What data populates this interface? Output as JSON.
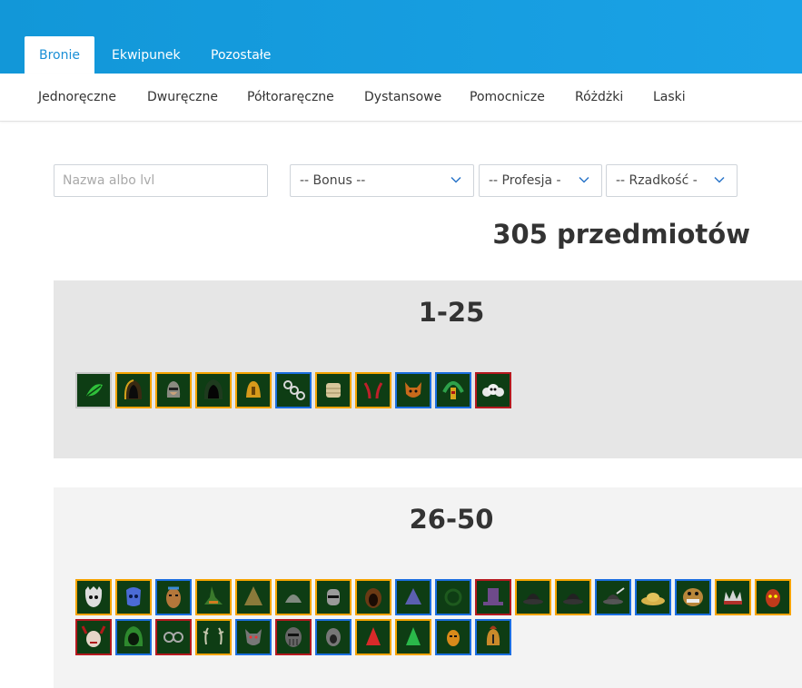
{
  "tabs": [
    {
      "label": "Bronie",
      "active": true
    },
    {
      "label": "Ekwipunek",
      "active": false
    },
    {
      "label": "Pozostałe",
      "active": false
    }
  ],
  "subnav": [
    "Jednoręczne",
    "Dwuręczne",
    "Półtoraręczne",
    "Dystansowe",
    "Pomocnicze",
    "Różdżki",
    "Laski"
  ],
  "filters": {
    "search_placeholder": "Nazwa albo lvl",
    "bonus": "-- Bonus --",
    "profession": "-- Profesja -",
    "rarity": "-- Rzadkość -"
  },
  "count_label": "305 przedmiotów",
  "colors": {
    "header": "#1aa2e6",
    "unique": "#f5a300",
    "heroic": "#1b6ee0",
    "legendary": "#b5191f",
    "common": "#c7c7c7",
    "item_bg": "#0e3d14"
  },
  "groups": [
    {
      "title": "1-25",
      "items": [
        {
          "rarity": "common",
          "icon": "green-leaf-icon"
        },
        {
          "rarity": "unique",
          "icon": "hood-icon"
        },
        {
          "rarity": "unique",
          "icon": "helmet-icon"
        },
        {
          "rarity": "unique",
          "icon": "dark-hood-icon"
        },
        {
          "rarity": "unique",
          "icon": "bell-helmet-icon"
        },
        {
          "rarity": "heroic",
          "icon": "chain-icon"
        },
        {
          "rarity": "unique",
          "icon": "wrap-icon"
        },
        {
          "rarity": "unique",
          "icon": "horns-icon"
        },
        {
          "rarity": "heroic",
          "icon": "fox-mask-icon"
        },
        {
          "rarity": "heroic",
          "icon": "feather-headdress-icon"
        },
        {
          "rarity": "legendary",
          "icon": "skull-crown-icon"
        }
      ]
    },
    {
      "title": "26-50",
      "items": [
        {
          "rarity": "unique",
          "icon": "skull-helmet-icon"
        },
        {
          "rarity": "unique",
          "icon": "blue-mask-icon"
        },
        {
          "rarity": "heroic",
          "icon": "tribal-mask-icon"
        },
        {
          "rarity": "unique",
          "icon": "witch-hat-icon"
        },
        {
          "rarity": "unique",
          "icon": "pointed-hat-icon"
        },
        {
          "rarity": "unique",
          "icon": "cap-icon"
        },
        {
          "rarity": "unique",
          "icon": "knight-helmet-icon"
        },
        {
          "rarity": "unique",
          "icon": "brown-hood-icon"
        },
        {
          "rarity": "heroic",
          "icon": "blue-hat-icon"
        },
        {
          "rarity": "heroic",
          "icon": "ring-icon"
        },
        {
          "rarity": "legendary",
          "icon": "top-hat-icon"
        },
        {
          "rarity": "unique",
          "icon": "bowler-hat-icon"
        },
        {
          "rarity": "unique",
          "icon": "bowler-hat-icon"
        },
        {
          "rarity": "heroic",
          "icon": "feather-hat-icon"
        },
        {
          "rarity": "heroic",
          "icon": "straw-hat-icon"
        },
        {
          "rarity": "heroic",
          "icon": "monster-mask-icon"
        },
        {
          "rarity": "unique",
          "icon": "spiked-crown-icon"
        },
        {
          "rarity": "unique",
          "icon": "demon-mask-icon"
        },
        {
          "rarity": "legendary",
          "icon": "horned-mask-icon"
        },
        {
          "rarity": "heroic",
          "icon": "green-hood-icon"
        },
        {
          "rarity": "legendary",
          "icon": "goggles-icon"
        },
        {
          "rarity": "unique",
          "icon": "antlers-icon"
        },
        {
          "rarity": "heroic",
          "icon": "wolf-mask-icon"
        },
        {
          "rarity": "legendary",
          "icon": "iron-mask-icon"
        },
        {
          "rarity": "heroic",
          "icon": "egg-helmet-icon"
        },
        {
          "rarity": "unique",
          "icon": "red-hat-icon"
        },
        {
          "rarity": "unique",
          "icon": "green-hat-icon"
        },
        {
          "rarity": "heroic",
          "icon": "gold-mask-icon"
        },
        {
          "rarity": "heroic",
          "icon": "gladiator-helmet-icon"
        }
      ]
    }
  ]
}
